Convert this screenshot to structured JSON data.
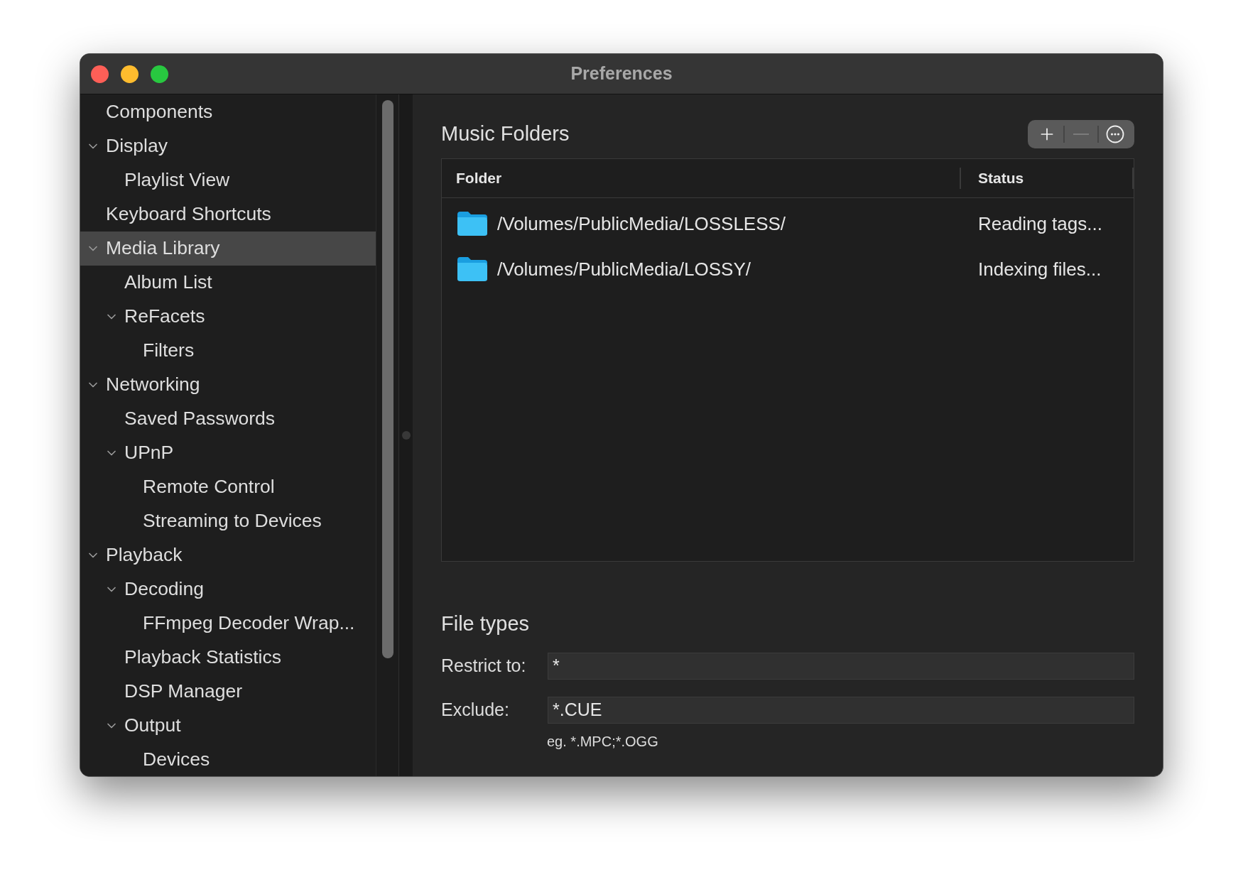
{
  "window": {
    "title": "Preferences"
  },
  "sidebar": {
    "items": [
      {
        "label": "Components",
        "selected": false
      },
      {
        "label": "Display",
        "selected": false,
        "expanded": true,
        "children": [
          {
            "label": "Playlist View",
            "selected": false
          }
        ]
      },
      {
        "label": "Keyboard Shortcuts",
        "selected": false
      },
      {
        "label": "Media Library",
        "selected": true,
        "expanded": true,
        "children": [
          {
            "label": "Album List",
            "selected": false
          },
          {
            "label": "ReFacets",
            "selected": false,
            "expanded": true,
            "children": [
              {
                "label": "Filters",
                "selected": false
              }
            ]
          }
        ]
      },
      {
        "label": "Networking",
        "selected": false,
        "expanded": true,
        "children": [
          {
            "label": "Saved Passwords",
            "selected": false
          },
          {
            "label": "UPnP",
            "selected": false,
            "expanded": true,
            "children": [
              {
                "label": "Remote Control",
                "selected": false
              },
              {
                "label": "Streaming to Devices",
                "selected": false
              }
            ]
          }
        ]
      },
      {
        "label": "Playback",
        "selected": false,
        "expanded": true,
        "children": [
          {
            "label": "Decoding",
            "selected": false,
            "expanded": true,
            "children": [
              {
                "label": "FFmpeg Decoder Wrap...",
                "selected": false
              }
            ]
          },
          {
            "label": "Playback Statistics",
            "selected": false
          },
          {
            "label": "DSP Manager",
            "selected": false
          },
          {
            "label": "Output",
            "selected": false,
            "expanded": true,
            "children": [
              {
                "label": "Devices",
                "selected": false
              }
            ]
          }
        ]
      }
    ]
  },
  "music_folders": {
    "title": "Music Folders",
    "toolbar": [
      {
        "kind": "add",
        "disabled": false
      },
      {
        "kind": "remove",
        "disabled": true
      },
      {
        "kind": "more",
        "disabled": false
      }
    ],
    "table": {
      "columns": [
        "Folder",
        "Status"
      ],
      "rows": [
        {
          "folder": "/Volumes/PublicMedia/LOSSLESS/",
          "status": "Reading tags..."
        },
        {
          "folder": "/Volumes/PublicMedia/LOSSY/",
          "status": "Indexing files..."
        }
      ]
    }
  },
  "file_types": {
    "title": "File types",
    "fields": [
      {
        "label": "Restrict to:",
        "value": "*"
      },
      {
        "label": "Exclude:",
        "value": "*.CUE"
      }
    ],
    "hint": "eg. *.MPC;*.OGG"
  }
}
